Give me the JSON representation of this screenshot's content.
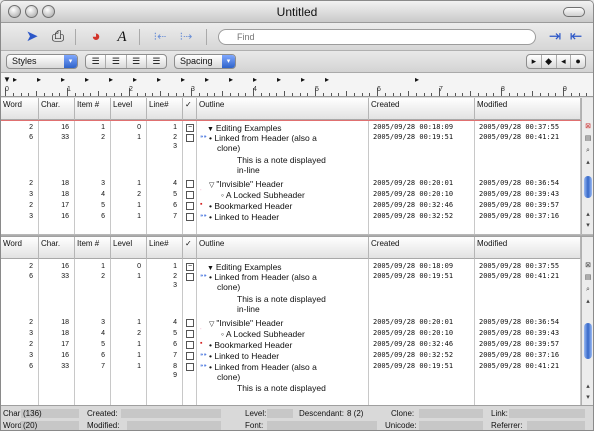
{
  "window": {
    "title": "Untitled"
  },
  "toolbar": {
    "search_placeholder": "Find"
  },
  "format": {
    "styles_label": "Styles",
    "spacing_label": "Spacing"
  },
  "ruler": {
    "numbers": [
      "0",
      "1",
      "2",
      "3",
      "4",
      "5",
      "6",
      "7",
      "8",
      "9"
    ]
  },
  "columns": [
    "Word",
    "Char.",
    "Item #",
    "Level",
    "Line#",
    "✓",
    "Outline",
    "Created",
    "Modified"
  ],
  "pane1": [
    {
      "word": "2",
      "char": "16",
      "item": "1",
      "level": "0",
      "line": "1",
      "line2": "",
      "check": "⊟",
      "mark": "",
      "tri": "▼",
      "bullet": "",
      "lines": [
        "Editing Examples"
      ],
      "created": "2005/09/28 00:18:09",
      "modified": "2005/09/28 00:37:55"
    },
    {
      "word": "6",
      "char": "33",
      "item": "2",
      "level": "1",
      "line": "2",
      "line2": "3",
      "check": "",
      "mark": "blue",
      "tri": "",
      "bullet": "•",
      "lines": [
        "Linked from Header (also a",
        "clone)"
      ],
      "created": "2005/09/28 00:19:51",
      "modified": "2005/09/28 00:41:21"
    },
    {
      "word": "",
      "char": "",
      "item": "",
      "level": "",
      "line": "",
      "line2": "",
      "check": "none",
      "mark": "",
      "tri": "",
      "bullet": "",
      "note": true,
      "lines": [
        "This is a note displayed",
        "in-line"
      ],
      "created": "",
      "modified": ""
    },
    {
      "word": "2",
      "char": "18",
      "item": "3",
      "level": "1",
      "line": "4",
      "line2": "",
      "check": "",
      "mark": "",
      "tri": "▽",
      "bullet": "",
      "lines": [
        "\"Invisible\" Header"
      ],
      "created": "2005/09/28 00:20:01",
      "modified": "2005/09/28 00:36:54"
    },
    {
      "word": "3",
      "char": "18",
      "item": "4",
      "level": "2",
      "line": "5",
      "line2": "",
      "check": "",
      "mark": "pink",
      "tri": "",
      "bullet": "◦",
      "indent": true,
      "lines": [
        "A Locked Subheader"
      ],
      "created": "2005/09/28 00:20:10",
      "modified": "2005/09/28 00:39:43"
    },
    {
      "word": "2",
      "char": "17",
      "item": "5",
      "level": "1",
      "line": "6",
      "line2": "",
      "check": "",
      "mark": "red",
      "tri": "",
      "bullet": "•",
      "lines": [
        "Bookmarked Header"
      ],
      "created": "2005/09/28 00:32:46",
      "modified": "2005/09/28 00:39:57"
    },
    {
      "word": "3",
      "char": "16",
      "item": "6",
      "level": "1",
      "line": "7",
      "line2": "",
      "check": "",
      "mark": "blue",
      "tri": "",
      "bullet": "•",
      "lines": [
        "Linked to Header"
      ],
      "created": "2005/09/28 00:32:52",
      "modified": "2005/09/28 00:37:16"
    }
  ],
  "pane2": [
    {
      "word": "2",
      "char": "16",
      "item": "1",
      "level": "0",
      "line": "1",
      "line2": "",
      "check": "⊟",
      "mark": "",
      "tri": "▼",
      "bullet": "",
      "lines": [
        "Editing Examples"
      ],
      "created": "2005/09/28 00:18:09",
      "modified": "2005/09/28 00:37:55"
    },
    {
      "word": "6",
      "char": "33",
      "item": "2",
      "level": "1",
      "line": "2",
      "line2": "3",
      "check": "",
      "mark": "blue",
      "tri": "",
      "bullet": "•",
      "lines": [
        "Linked from Header (also a",
        "clone)"
      ],
      "created": "2005/09/28 00:19:51",
      "modified": "2005/09/28 00:41:21"
    },
    {
      "word": "",
      "char": "",
      "item": "",
      "level": "",
      "line": "",
      "line2": "",
      "check": "none",
      "mark": "",
      "tri": "",
      "bullet": "",
      "note": true,
      "lines": [
        "This is a note displayed",
        "in-line"
      ],
      "created": "",
      "modified": ""
    },
    {
      "word": "2",
      "char": "18",
      "item": "3",
      "level": "1",
      "line": "4",
      "line2": "",
      "check": "",
      "mark": "",
      "tri": "▽",
      "bullet": "",
      "lines": [
        "\"Invisible\" Header"
      ],
      "created": "2005/09/28 00:20:01",
      "modified": "2005/09/28 00:36:54"
    },
    {
      "word": "3",
      "char": "18",
      "item": "4",
      "level": "2",
      "line": "5",
      "line2": "",
      "check": "",
      "mark": "pink",
      "tri": "",
      "bullet": "◦",
      "indent": true,
      "lines": [
        "A Locked Subheader"
      ],
      "created": "2005/09/28 00:20:10",
      "modified": "2005/09/28 00:39:43"
    },
    {
      "word": "2",
      "char": "17",
      "item": "5",
      "level": "1",
      "line": "6",
      "line2": "",
      "check": "",
      "mark": "red",
      "tri": "",
      "bullet": "•",
      "lines": [
        "Bookmarked Header"
      ],
      "created": "2005/09/28 00:32:46",
      "modified": "2005/09/28 00:39:57"
    },
    {
      "word": "3",
      "char": "16",
      "item": "6",
      "level": "1",
      "line": "7",
      "line2": "",
      "check": "",
      "mark": "blue",
      "tri": "",
      "bullet": "•",
      "lines": [
        "Linked to Header"
      ],
      "created": "2005/09/28 00:32:52",
      "modified": "2005/09/28 00:37:16"
    },
    {
      "word": "6",
      "char": "33",
      "item": "7",
      "level": "1",
      "line": "8",
      "line2": "9",
      "check": "",
      "mark": "blue",
      "tri": "",
      "bullet": "•",
      "lines": [
        "Linked from Header (also a",
        "clone)"
      ],
      "created": "2005/09/28 00:19:51",
      "modified": "2005/09/28 00:41:21"
    },
    {
      "word": "",
      "char": "",
      "item": "",
      "level": "",
      "line": "",
      "line2": "",
      "check": "none",
      "mark": "",
      "tri": "",
      "bullet": "",
      "note": true,
      "lines": [
        "This is a note displayed"
      ],
      "created": "",
      "modified": ""
    }
  ],
  "status": {
    "char_label": "Char:",
    "char_value": "(136)",
    "word_label": "Word:",
    "word_value": "(20)",
    "created_label": "Created:",
    "modified_label": "Modified:",
    "level_label": "Level:",
    "font_label": "Font:",
    "descendant_label": "Descendant:",
    "descendant_value": "8 (2)",
    "clone_label": "Clone:",
    "unicode_label": "Unicode:",
    "link_label": "Link:",
    "referrer_label": "Referrer:"
  },
  "colors": {
    "mark_blue": "#2b5fd9",
    "mark_red": "#d42020",
    "mark_pink": "#f06aa0",
    "scroll_blue": "#3568c8"
  }
}
